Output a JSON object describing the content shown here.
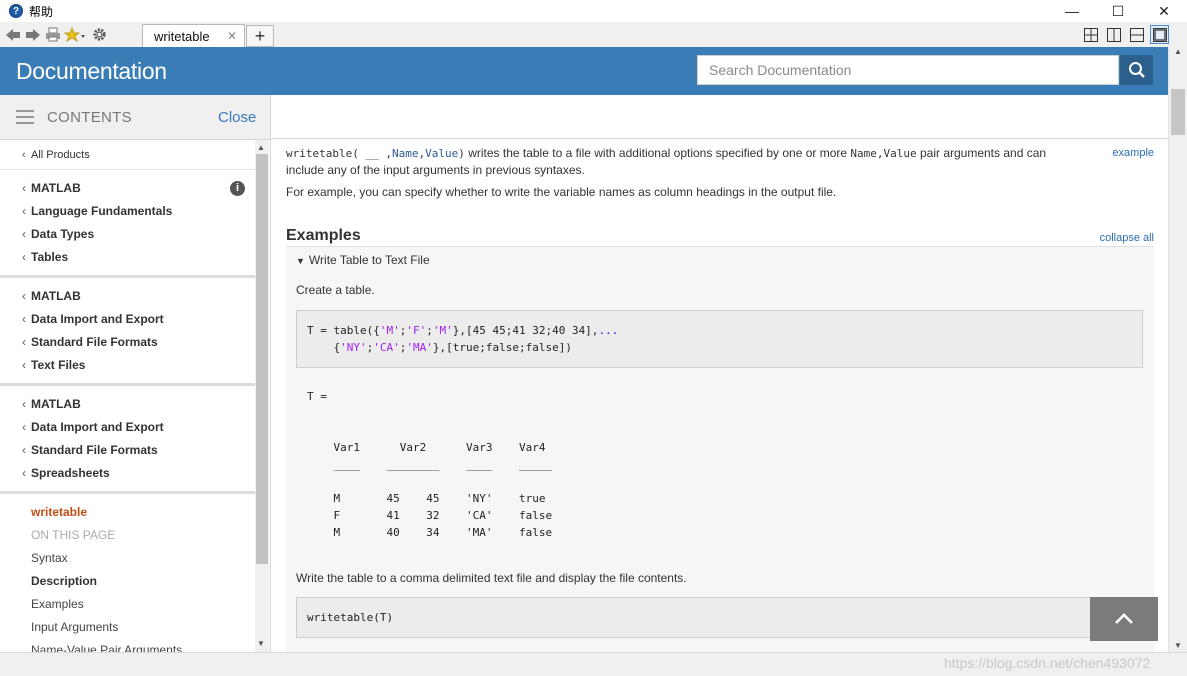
{
  "window": {
    "title": "帮助",
    "minimize": "—",
    "maximize": "☐",
    "close": "✕"
  },
  "tabs": [
    {
      "label": "writetable",
      "close": "✕"
    }
  ],
  "toolbar": {
    "new_tab": "+"
  },
  "header": {
    "title": "Documentation",
    "search_placeholder": "Search Documentation"
  },
  "sidebar": {
    "heading": "CONTENTS",
    "close_label": "Close",
    "all_products": "All Products",
    "groups": [
      [
        "MATLAB",
        "Language Fundamentals",
        "Data Types",
        "Tables"
      ],
      [
        "MATLAB",
        "Data Import and Export",
        "Standard File Formats",
        "Text Files"
      ],
      [
        "MATLAB",
        "Data Import and Export",
        "Standard File Formats",
        "Spreadsheets"
      ]
    ],
    "current": "writetable",
    "on_this_page_label": "ON THIS PAGE",
    "on_this_page": [
      "Syntax",
      "Description",
      "Examples",
      "Input Arguments",
      "Name-Value Pair Arguments"
    ]
  },
  "main": {
    "desc_fn": "writetable(",
    "desc_blank": " __ ",
    "desc_name": "Name",
    "desc_value": "Value",
    "desc_close": ")",
    "desc_text1": " writes the table to a file with additional options specified by one or more ",
    "desc_text2": " pair arguments and can include any of the input arguments in previous syntaxes.",
    "desc_name_value": "Name,Value",
    "example_link": "example",
    "desc2": "For example, you can specify whether to write the variable names as column headings in the output file.",
    "examples_title": "Examples",
    "collapse_all": "collapse all",
    "example": {
      "title": "Write Table to Text File",
      "text1": "Create a table.",
      "text2": "Write the table to a comma delimited text file and display the file contents.",
      "code2": "writetable(T)"
    }
  },
  "output": {
    "label": "T =",
    "headers": [
      "Var1",
      "Var2",
      "Var3",
      "Var4"
    ],
    "rows": [
      [
        "M",
        "45",
        "45",
        "'NY'",
        "true"
      ],
      [
        "F",
        "41",
        "32",
        "'CA'",
        "false"
      ],
      [
        "M",
        "40",
        "34",
        "'MA'",
        "false"
      ]
    ]
  },
  "watermark": "https://blog.csdn.net/chen493072",
  "colors": {
    "header_bg": "#3a7cb5",
    "search_btn": "#2c5f8c",
    "link": "#2b6cb0",
    "current_item": "#c0501a"
  }
}
